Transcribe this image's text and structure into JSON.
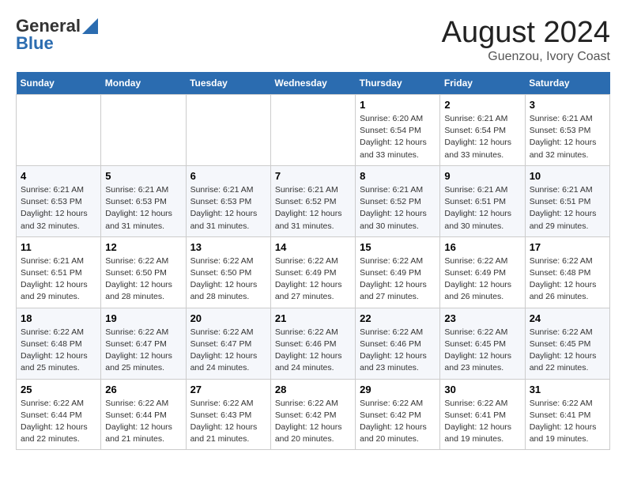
{
  "header": {
    "logo_general": "General",
    "logo_blue": "Blue",
    "title": "August 2024",
    "subtitle": "Guenzou, Ivory Coast"
  },
  "calendar": {
    "days_of_week": [
      "Sunday",
      "Monday",
      "Tuesday",
      "Wednesday",
      "Thursday",
      "Friday",
      "Saturday"
    ],
    "weeks": [
      [
        {
          "day": "",
          "info": ""
        },
        {
          "day": "",
          "info": ""
        },
        {
          "day": "",
          "info": ""
        },
        {
          "day": "",
          "info": ""
        },
        {
          "day": "1",
          "info": "Sunrise: 6:20 AM\nSunset: 6:54 PM\nDaylight: 12 hours\nand 33 minutes."
        },
        {
          "day": "2",
          "info": "Sunrise: 6:21 AM\nSunset: 6:54 PM\nDaylight: 12 hours\nand 33 minutes."
        },
        {
          "day": "3",
          "info": "Sunrise: 6:21 AM\nSunset: 6:53 PM\nDaylight: 12 hours\nand 32 minutes."
        }
      ],
      [
        {
          "day": "4",
          "info": "Sunrise: 6:21 AM\nSunset: 6:53 PM\nDaylight: 12 hours\nand 32 minutes."
        },
        {
          "day": "5",
          "info": "Sunrise: 6:21 AM\nSunset: 6:53 PM\nDaylight: 12 hours\nand 31 minutes."
        },
        {
          "day": "6",
          "info": "Sunrise: 6:21 AM\nSunset: 6:53 PM\nDaylight: 12 hours\nand 31 minutes."
        },
        {
          "day": "7",
          "info": "Sunrise: 6:21 AM\nSunset: 6:52 PM\nDaylight: 12 hours\nand 31 minutes."
        },
        {
          "day": "8",
          "info": "Sunrise: 6:21 AM\nSunset: 6:52 PM\nDaylight: 12 hours\nand 30 minutes."
        },
        {
          "day": "9",
          "info": "Sunrise: 6:21 AM\nSunset: 6:51 PM\nDaylight: 12 hours\nand 30 minutes."
        },
        {
          "day": "10",
          "info": "Sunrise: 6:21 AM\nSunset: 6:51 PM\nDaylight: 12 hours\nand 29 minutes."
        }
      ],
      [
        {
          "day": "11",
          "info": "Sunrise: 6:21 AM\nSunset: 6:51 PM\nDaylight: 12 hours\nand 29 minutes."
        },
        {
          "day": "12",
          "info": "Sunrise: 6:22 AM\nSunset: 6:50 PM\nDaylight: 12 hours\nand 28 minutes."
        },
        {
          "day": "13",
          "info": "Sunrise: 6:22 AM\nSunset: 6:50 PM\nDaylight: 12 hours\nand 28 minutes."
        },
        {
          "day": "14",
          "info": "Sunrise: 6:22 AM\nSunset: 6:49 PM\nDaylight: 12 hours\nand 27 minutes."
        },
        {
          "day": "15",
          "info": "Sunrise: 6:22 AM\nSunset: 6:49 PM\nDaylight: 12 hours\nand 27 minutes."
        },
        {
          "day": "16",
          "info": "Sunrise: 6:22 AM\nSunset: 6:49 PM\nDaylight: 12 hours\nand 26 minutes."
        },
        {
          "day": "17",
          "info": "Sunrise: 6:22 AM\nSunset: 6:48 PM\nDaylight: 12 hours\nand 26 minutes."
        }
      ],
      [
        {
          "day": "18",
          "info": "Sunrise: 6:22 AM\nSunset: 6:48 PM\nDaylight: 12 hours\nand 25 minutes."
        },
        {
          "day": "19",
          "info": "Sunrise: 6:22 AM\nSunset: 6:47 PM\nDaylight: 12 hours\nand 25 minutes."
        },
        {
          "day": "20",
          "info": "Sunrise: 6:22 AM\nSunset: 6:47 PM\nDaylight: 12 hours\nand 24 minutes."
        },
        {
          "day": "21",
          "info": "Sunrise: 6:22 AM\nSunset: 6:46 PM\nDaylight: 12 hours\nand 24 minutes."
        },
        {
          "day": "22",
          "info": "Sunrise: 6:22 AM\nSunset: 6:46 PM\nDaylight: 12 hours\nand 23 minutes."
        },
        {
          "day": "23",
          "info": "Sunrise: 6:22 AM\nSunset: 6:45 PM\nDaylight: 12 hours\nand 23 minutes."
        },
        {
          "day": "24",
          "info": "Sunrise: 6:22 AM\nSunset: 6:45 PM\nDaylight: 12 hours\nand 22 minutes."
        }
      ],
      [
        {
          "day": "25",
          "info": "Sunrise: 6:22 AM\nSunset: 6:44 PM\nDaylight: 12 hours\nand 22 minutes."
        },
        {
          "day": "26",
          "info": "Sunrise: 6:22 AM\nSunset: 6:44 PM\nDaylight: 12 hours\nand 21 minutes."
        },
        {
          "day": "27",
          "info": "Sunrise: 6:22 AM\nSunset: 6:43 PM\nDaylight: 12 hours\nand 21 minutes."
        },
        {
          "day": "28",
          "info": "Sunrise: 6:22 AM\nSunset: 6:42 PM\nDaylight: 12 hours\nand 20 minutes."
        },
        {
          "day": "29",
          "info": "Sunrise: 6:22 AM\nSunset: 6:42 PM\nDaylight: 12 hours\nand 20 minutes."
        },
        {
          "day": "30",
          "info": "Sunrise: 6:22 AM\nSunset: 6:41 PM\nDaylight: 12 hours\nand 19 minutes."
        },
        {
          "day": "31",
          "info": "Sunrise: 6:22 AM\nSunset: 6:41 PM\nDaylight: 12 hours\nand 19 minutes."
        }
      ]
    ]
  }
}
